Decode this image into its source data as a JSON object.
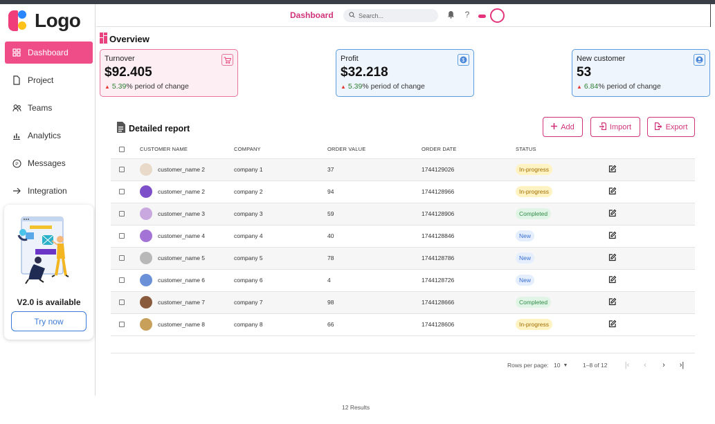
{
  "app": {
    "logo_text": "Logo"
  },
  "sidebar": {
    "items": [
      {
        "label": "Dashboard",
        "icon": "grid-icon",
        "active": true
      },
      {
        "label": "Project",
        "icon": "document-icon"
      },
      {
        "label": "Teams",
        "icon": "users-icon"
      },
      {
        "label": "Analytics",
        "icon": "bar-chart-icon"
      },
      {
        "label": "Messages",
        "icon": "message-icon"
      },
      {
        "label": "Integration",
        "icon": "arrow-right-icon"
      }
    ],
    "promo": {
      "title": "V2.0 is available",
      "button": "Try now"
    }
  },
  "header": {
    "title": "Dashboard",
    "search_placeholder": "Search..."
  },
  "overview": {
    "title": "Overview",
    "cards": [
      {
        "label": "Turnover",
        "value": "$92.405",
        "change": "5.39",
        "suffix": "% period of change",
        "bg": "#fdeef3",
        "border": "#e8739b",
        "icon": "cart-icon"
      },
      {
        "label": "Profit",
        "value": "$32.218",
        "change": "5.39",
        "suffix": "% period of change",
        "bg": "#eef5fd",
        "border": "#5b9be0",
        "icon": "dollar-icon"
      },
      {
        "label": "New customer",
        "value": "53",
        "change": "6.84",
        "suffix": "% period of change",
        "bg": "#eef5fd",
        "border": "#5b9be0",
        "icon": "user-icon"
      }
    ]
  },
  "report": {
    "title": "Detailed report",
    "actions": {
      "add": "Add",
      "import": "Import",
      "export": "Export"
    },
    "columns": [
      "CUSTOMER NAME",
      "COMPANY",
      "ORDER VALUE",
      "ORDER DATE",
      "STATUS"
    ],
    "rows": [
      {
        "name": "customer_name 2",
        "company": "company 1",
        "value": "37",
        "date": "1744129026",
        "status": "In-progress",
        "avatar": "#e8d9c8"
      },
      {
        "name": "customer_name 2",
        "company": "company 2",
        "value": "94",
        "date": "1744128966",
        "status": "In-progress",
        "avatar": "#7d4fc9"
      },
      {
        "name": "customer_name 3",
        "company": "company 3",
        "value": "59",
        "date": "1744128906",
        "status": "Completed",
        "avatar": "#c9a8e0"
      },
      {
        "name": "customer_name 4",
        "company": "company 4",
        "value": "40",
        "date": "1744128846",
        "status": "New",
        "avatar": "#a473d6"
      },
      {
        "name": "customer_name 5",
        "company": "company 5",
        "value": "78",
        "date": "1744128786",
        "status": "New",
        "avatar": "#b8b8b8"
      },
      {
        "name": "customer_name 6",
        "company": "company 6",
        "value": "4",
        "date": "1744128726",
        "status": "New",
        "avatar": "#6a90d8"
      },
      {
        "name": "customer_name 7",
        "company": "company 7",
        "value": "98",
        "date": "1744128666",
        "status": "Completed",
        "avatar": "#8a5a3c"
      },
      {
        "name": "customer_name 8",
        "company": "company 8",
        "value": "66",
        "date": "1744128606",
        "status": "In-progress",
        "avatar": "#c9a05a"
      }
    ]
  },
  "pagination": {
    "rows_per_page_label": "Rows per page:",
    "rows_per_page": "10",
    "range": "1–8 of 12"
  },
  "footer": {
    "results": "12 Results"
  }
}
